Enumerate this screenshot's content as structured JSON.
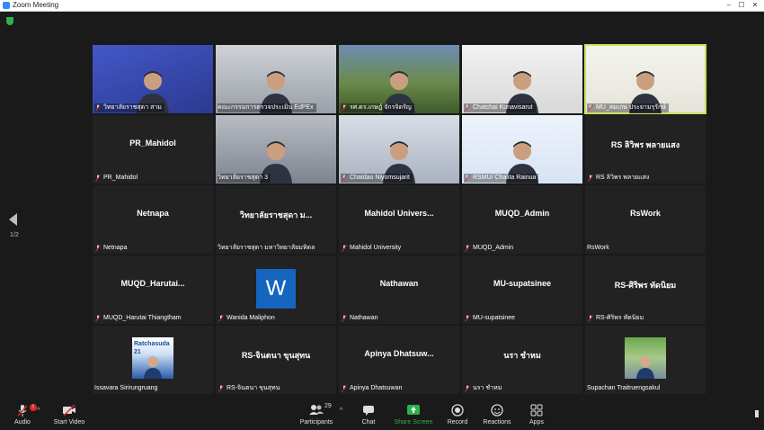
{
  "window": {
    "title": "Zoom Meeting"
  },
  "pagination": {
    "indicator": "1/2"
  },
  "tiles": [
    {
      "caption": "วิทยาลัยราชสุดา สาม",
      "muted": true,
      "video": true,
      "pin": true
    },
    {
      "caption": "คณะกรรมการตรวจประเมิน EdPEx",
      "muted": false,
      "video": true,
      "pin": true
    },
    {
      "caption": "รศ.ดร.เกษฎ์ จักรจิตรัญ",
      "muted": true,
      "video": true,
      "pin": true
    },
    {
      "caption": "Chatchai Kunavisarut",
      "muted": true,
      "video": true
    },
    {
      "caption": "MU_สมเกษ ประยามรุรักษ์",
      "muted": true,
      "video": true
    },
    {
      "name": "PR_Mahidol",
      "caption": "PR_Mahidol",
      "muted": true
    },
    {
      "caption": "วิทยาลัยราชสุดา 3",
      "muted": false,
      "video": true,
      "pin": true
    },
    {
      "caption": "Chatdao Niyomsujarit",
      "muted": true,
      "video": true
    },
    {
      "caption": "RSMU/ Chalita Rainua",
      "muted": true,
      "video": true
    },
    {
      "name": "RS ลิวิพร พลายแสง",
      "caption": "RS ลิวิพร พลายแสง",
      "muted": true
    },
    {
      "name": "Netnapa",
      "caption": "Netnapa",
      "muted": true
    },
    {
      "name": "วิทยาลัยราชสุดา ม...",
      "caption": "วิทยาลัยราชสุดา มหาวิทยาลัยมหิดล",
      "muted": false
    },
    {
      "name": "Mahidol Univers...",
      "caption": "Mahidol University",
      "muted": true
    },
    {
      "name": "MUQD_Admin",
      "caption": "MUQD_Admin",
      "muted": true
    },
    {
      "name": "RsWork",
      "caption": "RsWork",
      "muted": false
    },
    {
      "name": "MUQD_Harutai...",
      "caption": "MUQD_Harutai Thiangtham",
      "muted": true
    },
    {
      "caption": "Wanida Maliphon",
      "muted": true,
      "avatar_letter": "W"
    },
    {
      "name": "Nathawan",
      "caption": "Nathawan",
      "muted": true
    },
    {
      "name": "MU-supatsinee",
      "caption": "MU-supatsinee",
      "muted": true
    },
    {
      "name": "RS-ศิริพร ทัดนิยม",
      "caption": "RS-ศิริพร ทัดนิยม",
      "muted": true
    },
    {
      "caption": "Issavara Sirirungruang",
      "muted": false,
      "photo": "Ratchasuda 21"
    },
    {
      "name": "RS-จินตนา ขุนสุทน",
      "caption": "RS-จินตนา ขุนสุทน",
      "muted": true
    },
    {
      "name": "Apinya Dhatsuw...",
      "caption": "Apinya Dhatsuwan",
      "muted": true
    },
    {
      "name": "นรา ชำหม",
      "caption": "นรา ชำหม",
      "muted": true
    },
    {
      "caption": "Supachan Traitruengsakul",
      "muted": false,
      "photo": ""
    }
  ],
  "toolbar": {
    "audio": "Audio",
    "start_video": "Start Video",
    "participants": "Participants",
    "participants_count": "29",
    "chat": "Chat",
    "share_screen": "Share Screen",
    "record": "Record",
    "reactions": "Reactions",
    "apps": "Apps",
    "audio_badge": "!"
  },
  "colors": {
    "share_green": "#2bb24c",
    "mute_red": "#e02828",
    "active_speaker": "#c8e35b",
    "wanida_tile_blue": "#1565c0"
  }
}
